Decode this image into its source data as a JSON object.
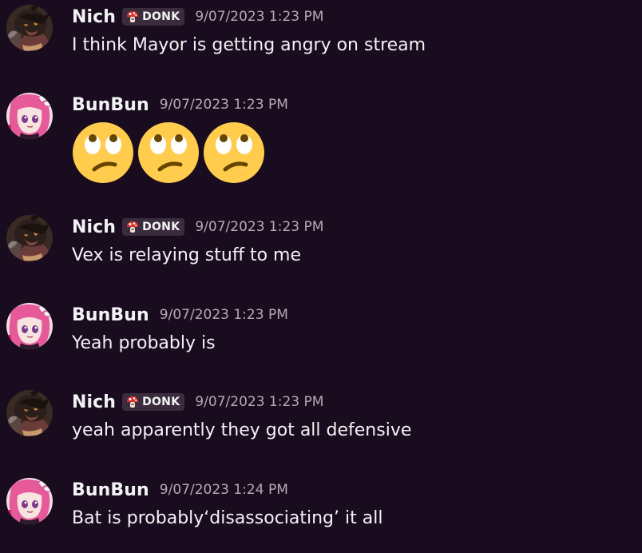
{
  "colors": {
    "background": "#1a0c1f",
    "text": "#f2f3f5",
    "timestamp": "#b5a9b9",
    "role_tag_bg": "#3a2c3d"
  },
  "messages": [
    {
      "username": "Nich",
      "role": {
        "icon": "mushroom-icon",
        "label": "DONK"
      },
      "timestamp": "9/07/2023 1:23 PM",
      "text": "I think Mayor is getting angry on stream"
    },
    {
      "username": "BunBun",
      "timestamp": "9/07/2023 1:23 PM",
      "emojis": [
        "🙄",
        "🙄",
        "🙄"
      ],
      "emoji_icon": "eye-roll-emoji-icon"
    },
    {
      "username": "Nich",
      "role": {
        "icon": "mushroom-icon",
        "label": "DONK"
      },
      "timestamp": "9/07/2023 1:23 PM",
      "text": "Vex is relaying stuff to me"
    },
    {
      "username": "BunBun",
      "timestamp": "9/07/2023 1:23 PM",
      "text": "Yeah probably is"
    },
    {
      "username": "Nich",
      "role": {
        "icon": "mushroom-icon",
        "label": "DONK"
      },
      "timestamp": "9/07/2023 1:23 PM",
      "text": "yeah apparently they got all defensive"
    },
    {
      "username": "BunBun",
      "timestamp": "9/07/2023 1:24 PM",
      "text": "Bat is probably‘disassociating’ it all"
    }
  ]
}
